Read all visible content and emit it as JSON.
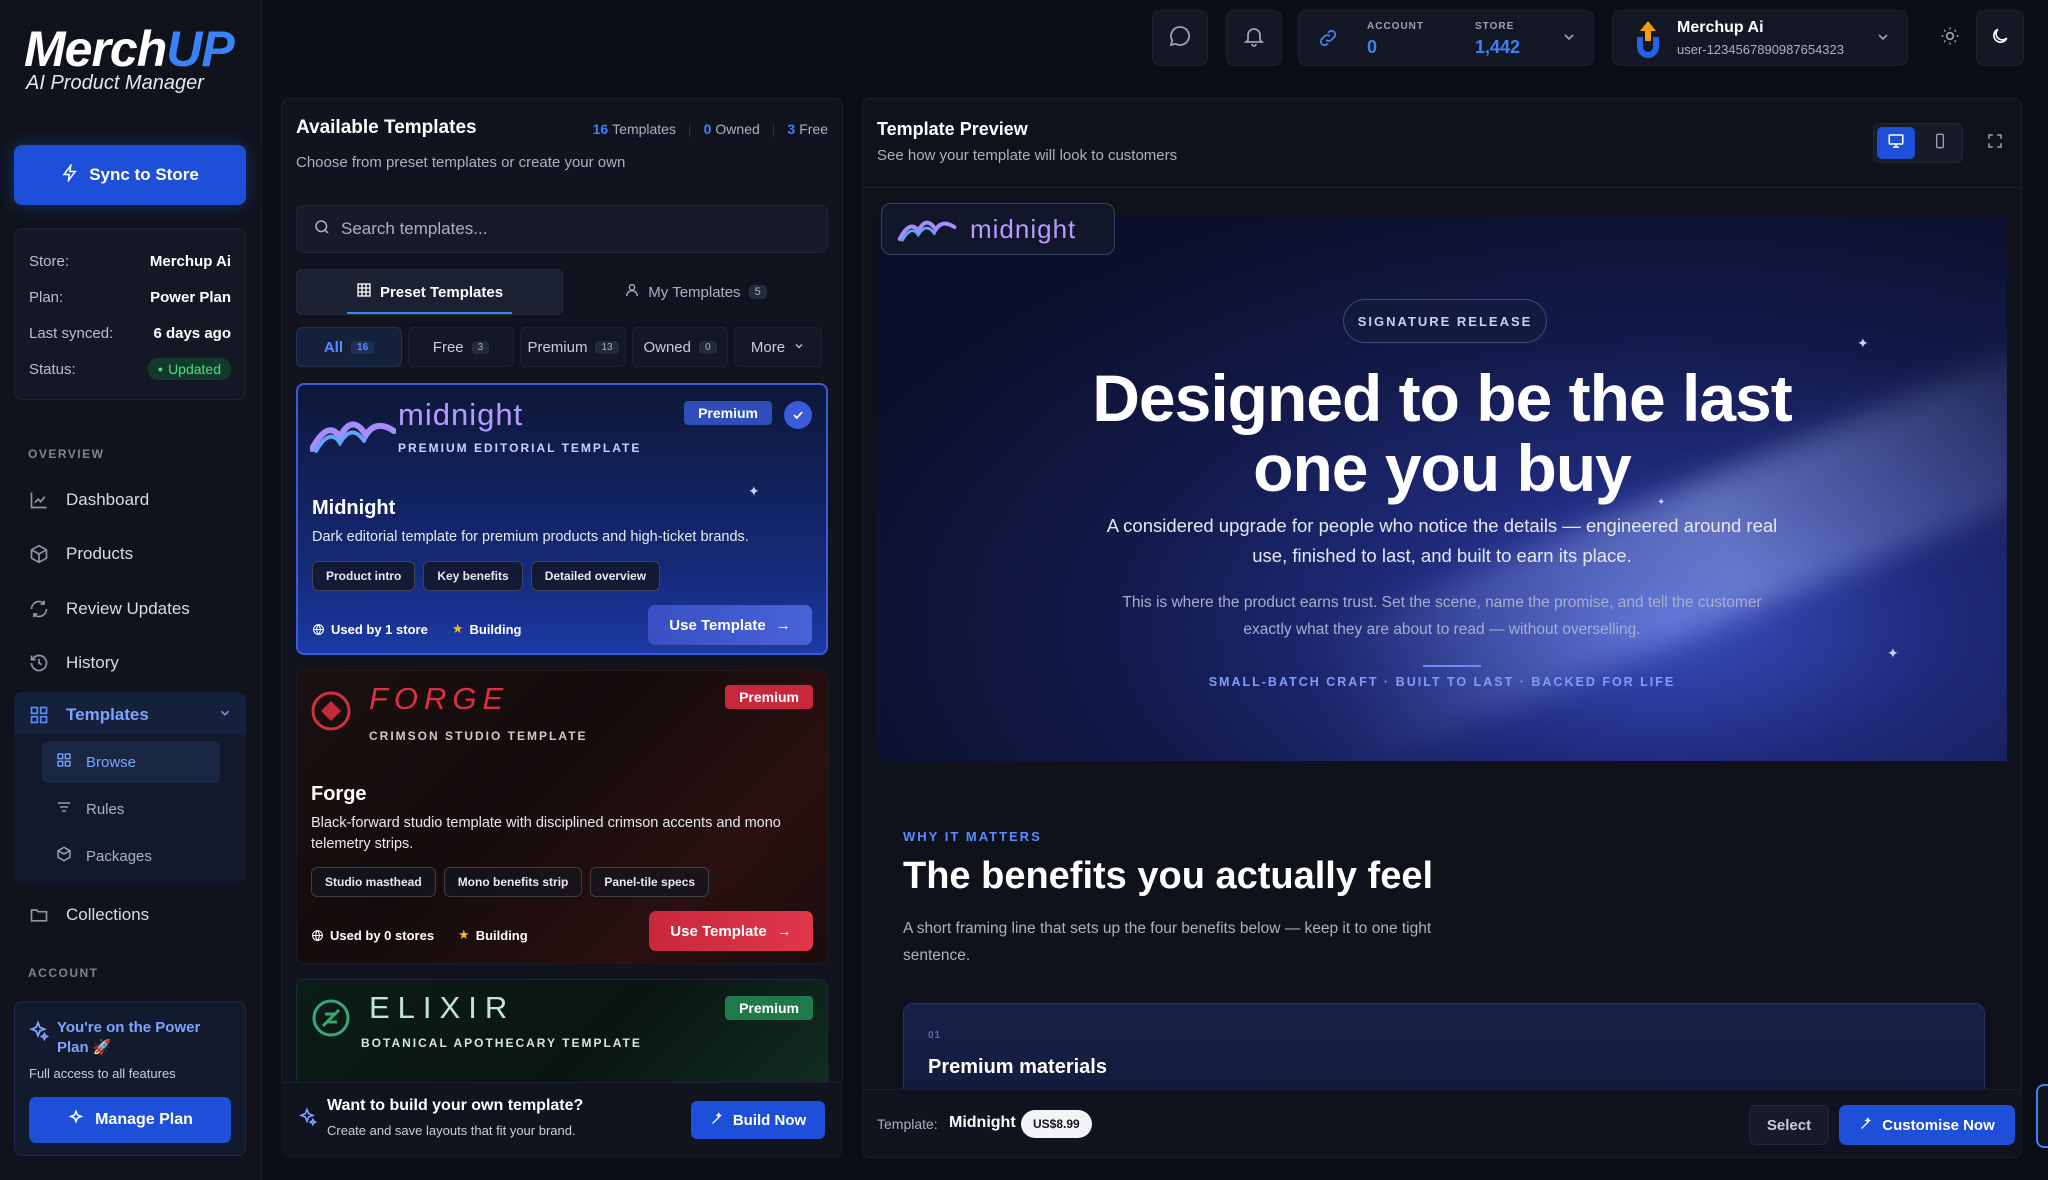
{
  "brand": {
    "name_a": "Merch",
    "name_b": "UP",
    "tagline": "AI Product Manager"
  },
  "sidebar": {
    "sync_label": "Sync to Store",
    "store": [
      {
        "k": "Store:",
        "v": "Merchup Ai"
      },
      {
        "k": "Plan:",
        "v": "Power Plan"
      },
      {
        "k": "Last synced:",
        "v": "6 days ago"
      },
      {
        "k": "Status:",
        "v": "Updated"
      }
    ],
    "overview_label": "OVERVIEW",
    "nav": {
      "dashboard": "Dashboard",
      "products": "Products",
      "review": "Review Updates",
      "history": "History",
      "templates": "Templates",
      "collections": "Collections"
    },
    "sub": {
      "browse": "Browse",
      "rules": "Rules",
      "packages": "Packages"
    },
    "account_label": "ACCOUNT",
    "power": {
      "title": "You're on the Power Plan 🚀",
      "sub": "Full access to all features",
      "button": "Manage Plan"
    }
  },
  "topbar": {
    "account_label": "ACCOUNT",
    "account_value": "0",
    "store_label": "STORE",
    "store_value": "1,442",
    "user_name": "Merchup Ai",
    "user_id": "user-1234567890987654323"
  },
  "templates": {
    "title": "Available Templates",
    "subtitle": "Choose from preset templates or create your own",
    "stats": {
      "templates_count": "16",
      "templates_label": "Templates",
      "owned_count": "0",
      "owned_label": "Owned",
      "free_count": "3",
      "free_label": "Free"
    },
    "search_placeholder": "Search templates...",
    "tabs": {
      "preset": "Preset Templates",
      "mine": "My Templates",
      "mine_count": "5"
    },
    "filters": [
      {
        "label": "All",
        "count": "16"
      },
      {
        "label": "Free",
        "count": "3"
      },
      {
        "label": "Premium",
        "count": "13"
      },
      {
        "label": "Owned",
        "count": "0"
      },
      {
        "label": "More",
        "count": ""
      }
    ],
    "cards": [
      {
        "brand": "midnight",
        "tagline": "PREMIUM EDITORIAL TEMPLATE",
        "badge": "Premium",
        "name": "Midnight",
        "desc": "Dark editorial template for premium products and high-ticket brands.",
        "chips": [
          "Product intro",
          "Key benefits",
          "Detailed overview"
        ],
        "used": "Used by 1 store",
        "status": "Building",
        "cta": "Use Template"
      },
      {
        "brand": "FORGE",
        "tagline": "CRIMSON STUDIO TEMPLATE",
        "badge": "Premium",
        "name": "Forge",
        "desc": "Black-forward studio template with disciplined crimson accents and mono telemetry strips.",
        "chips": [
          "Studio masthead",
          "Mono benefits strip",
          "Panel-tile specs"
        ],
        "used": "Used by 0 stores",
        "status": "Building",
        "cta": "Use Template"
      },
      {
        "brand": "ELIXIR",
        "tagline": "BOTANICAL APOTHECARY TEMPLATE",
        "badge": "Premium"
      }
    ],
    "build": {
      "title": "Want to build your own template?",
      "sub": "Create and save layouts that fit your brand.",
      "button": "Build Now"
    }
  },
  "preview": {
    "title": "Template Preview",
    "subtitle": "See how your template will look to customers",
    "logo_word": "midnight",
    "signature": "SIGNATURE RELEASE",
    "headline_1": "Designed to be the last",
    "headline_2": "one you buy",
    "para_1": "A considered upgrade for people who notice the details — engineered around real use, finished to last, and built to earn its place.",
    "para_2": "This is where the product earns trust. Set the scene, name the promise, and tell the customer exactly what they are about to read — without overselling.",
    "tags": "SMALL-BATCH CRAFT · BUILT TO LAST · BACKED FOR LIFE",
    "why": "WHY IT MATTERS",
    "benefits_title": "The benefits you actually feel",
    "benefits_sub": "A short framing line that sets up the four benefits below — keep it to one tight sentence.",
    "benefit_num": "01",
    "benefit_title": "Premium materials",
    "footer": {
      "label": "Template:",
      "name": "Midnight",
      "price": "US$8.99",
      "select": "Select",
      "customise": "Customise Now"
    }
  },
  "colors": {
    "accent": "#1d4fd8",
    "premium_blue": "#3b5bdb",
    "premium_red": "#c8283c",
    "premium_green": "#1e7a4a"
  }
}
